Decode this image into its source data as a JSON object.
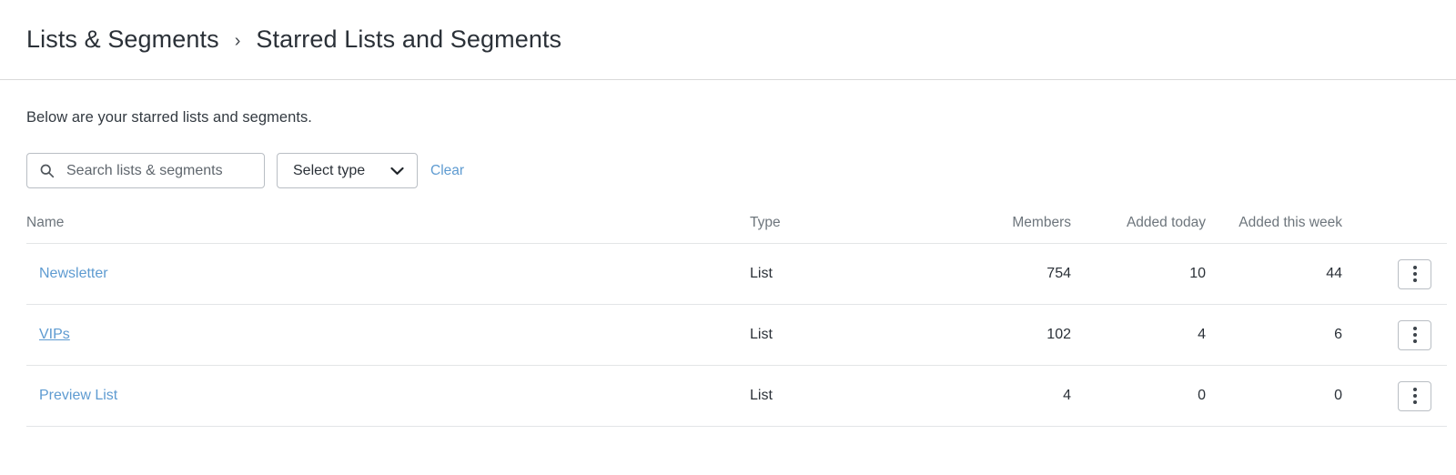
{
  "breadcrumb": {
    "parent": "Lists & Segments",
    "separator": "›",
    "current": "Starred Lists and Segments"
  },
  "intro": "Below are your starred lists and segments.",
  "toolbar": {
    "search_icon": "search-icon",
    "search_placeholder": "Search lists & segments",
    "search_value": "",
    "select_type_label": "Select type",
    "chevron_icon": "chevron-down-icon",
    "clear_label": "Clear"
  },
  "table": {
    "columns": {
      "name": "Name",
      "type": "Type",
      "members": "Members",
      "added_today": "Added today",
      "added_this_week": "Added this week"
    },
    "rows": [
      {
        "name": "Newsletter",
        "type": "List",
        "members": "754",
        "added_today": "10",
        "added_this_week": "44",
        "hovered": false
      },
      {
        "name": "VIPs",
        "type": "List",
        "members": "102",
        "added_today": "4",
        "added_this_week": "6",
        "hovered": true
      },
      {
        "name": "Preview List",
        "type": "List",
        "members": "4",
        "added_today": "0",
        "added_this_week": "0",
        "hovered": false
      }
    ],
    "row_menu_icon": "kebab-menu-icon"
  },
  "colors": {
    "link": "#5e9bd1",
    "text": "#2b3138",
    "muted": "#6d757c",
    "border": "#e3e5e7",
    "control_border": "#b9bec4"
  }
}
